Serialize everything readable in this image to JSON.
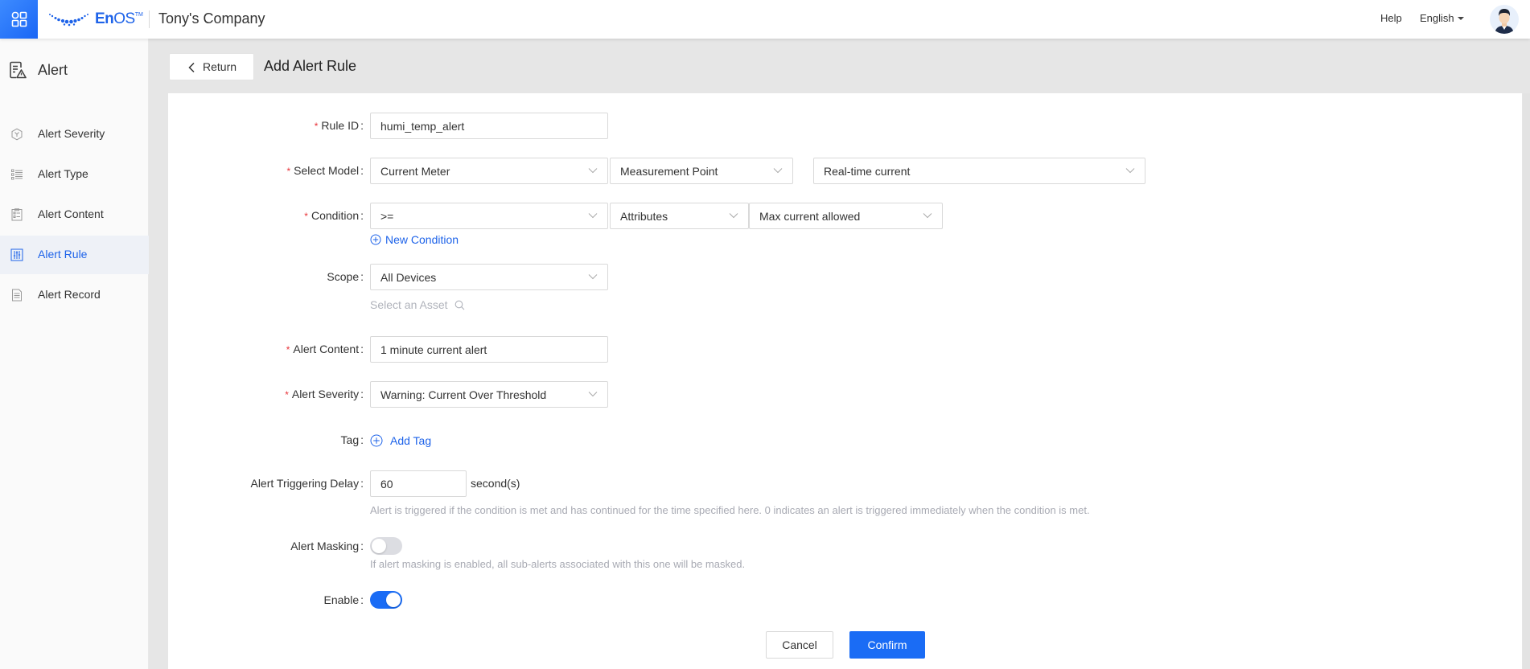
{
  "topbar": {
    "apps_icon": "grid-apps-icon",
    "logo_brand": "En",
    "logo_brand_rest": "OS",
    "logo_tm": "TM",
    "company": "Tony's Company",
    "help": "Help",
    "language": "English",
    "avatar_icon": "user-avatar"
  },
  "sidebar": {
    "title": "Alert",
    "title_icon": "alert-document-icon",
    "items": [
      {
        "label": "Alert Severity",
        "icon": "hexagon-y-icon",
        "active": false
      },
      {
        "label": "Alert Type",
        "icon": "list-icon",
        "active": false
      },
      {
        "label": "Alert Content",
        "icon": "clipboard-icon",
        "active": false
      },
      {
        "label": "Alert Rule",
        "icon": "sliders-icon",
        "active": true
      },
      {
        "label": "Alert Record",
        "icon": "document-icon",
        "active": false
      }
    ]
  },
  "header": {
    "return_label": "Return",
    "title": "Add Alert Rule"
  },
  "form": {
    "rule_id": {
      "label": "Rule ID",
      "required": true,
      "value": "humi_temp_alert"
    },
    "select_model": {
      "label": "Select Model",
      "required": true,
      "model": "Current Meter",
      "point_type": "Measurement Point",
      "point": "Real-time current"
    },
    "condition": {
      "label": "Condition",
      "required": true,
      "operator": ">=",
      "value_type": "Attributes",
      "value": "Max current allowed",
      "new_condition_label": "New Condition"
    },
    "scope": {
      "label": "Scope",
      "required": false,
      "value": "All Devices",
      "asset_placeholder": "Select an Asset"
    },
    "alert_content": {
      "label": "Alert Content",
      "required": true,
      "value": "1 minute current alert"
    },
    "alert_severity": {
      "label": "Alert Severity",
      "required": true,
      "value": "Warning: Current Over Threshold"
    },
    "tag": {
      "label": "Tag",
      "add_label": "Add Tag"
    },
    "delay": {
      "label": "Alert Triggering Delay",
      "value": "60",
      "unit": "second(s)",
      "hint": "Alert is triggered if the condition is met and has continued for the time specified here. 0 indicates an alert is triggered immediately when the condition is met."
    },
    "masking": {
      "label": "Alert Masking",
      "enabled": false,
      "hint": "If alert masking is enabled, all sub-alerts associated with this one will be masked."
    },
    "enable": {
      "label": "Enable",
      "enabled": true
    },
    "required_mark": "*",
    "colon": ":"
  },
  "actions": {
    "cancel": "Cancel",
    "confirm": "Confirm"
  },
  "colors": {
    "primary": "#1a6cf5",
    "required": "#e8343a",
    "muted": "#a8aab3",
    "active_bg": "#eef1f7"
  }
}
